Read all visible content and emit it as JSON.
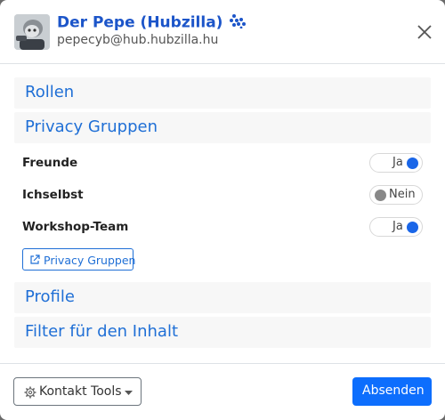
{
  "header": {
    "title": "Der Pepe (Hubzilla)",
    "subtitle": "pepecyb@hub.hubzilla.hu",
    "title_icon": "snowflake-icon",
    "close_icon": "close-icon"
  },
  "sections": {
    "rollen": "Rollen",
    "privacy_gruppen": "Privacy Gruppen",
    "profile": "Profile",
    "filter": "Filter für den Inhalt"
  },
  "groups": [
    {
      "label": "Freunde",
      "state": "Ja",
      "on": true
    },
    {
      "label": "Ichselbst",
      "state": "Nein",
      "on": false
    },
    {
      "label": "Workshop-Team",
      "state": "Ja",
      "on": true
    }
  ],
  "privacy_link": "Privacy Gruppen",
  "footer": {
    "tools_label": "Kontakt Tools",
    "send_label": "Absenden"
  },
  "colors": {
    "accent": "#1f6fd6",
    "primary_button": "#0d6efd",
    "toggle_on": "#1a66e8"
  }
}
